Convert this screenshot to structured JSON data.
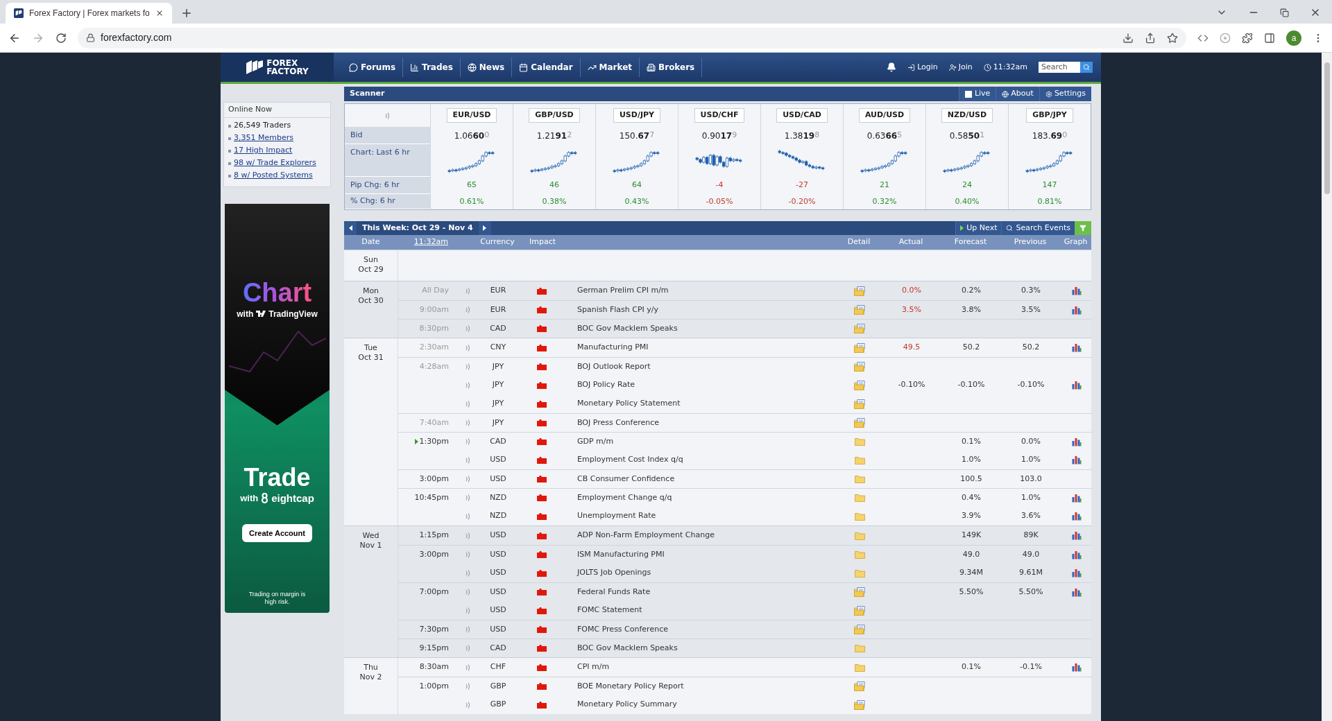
{
  "browser": {
    "tab_title": "Forex Factory | Forex markets fo",
    "url": "forexfactory.com",
    "profile_initial": "a"
  },
  "header": {
    "logo": [
      "FOREX",
      "FACTORY"
    ],
    "navigation": [
      {
        "label": "Forums"
      },
      {
        "label": "Trades"
      },
      {
        "label": "News"
      },
      {
        "label": "Calendar"
      },
      {
        "label": "Market"
      },
      {
        "label": "Brokers"
      }
    ],
    "login": "Login",
    "join": "Join",
    "time": "11:32am",
    "search": {
      "placeholder": "Search"
    }
  },
  "sidebar": {
    "title": "Online Now",
    "items": [
      {
        "label": "26,549 Traders",
        "kind": "text"
      },
      {
        "label": "3,351 Members",
        "kind": "link"
      },
      {
        "label": "17 High Impact",
        "kind": "link"
      },
      {
        "label": "98 w/ Trade Explorers",
        "kind": "link"
      },
      {
        "label": "8 w/ Posted Systems",
        "kind": "link"
      }
    ],
    "ad": {
      "headline": "Chart",
      "with_1": "with",
      "brand_1": "TradingView",
      "headline_2": "Trade",
      "with_2": "with",
      "brand_2": "eightcap",
      "cta": "Create Account",
      "disclaimer": "Trading on margin is high risk."
    }
  },
  "scanner": {
    "title": "Scanner",
    "live": {
      "label": "Live",
      "checked": false
    },
    "about": "About",
    "settings": "Settings",
    "row_labels": [
      "Bid",
      "Chart: Last 6 hr",
      "Pip Chg: 6 hr",
      "% Chg: 6 hr"
    ],
    "pairs": [
      {
        "symbol": "EUR/USD",
        "bid_main": "1.06",
        "bid_pips": "60",
        "bid_fraction": "0",
        "kind": "rising",
        "pip_change": "65",
        "pct_change": "0.61%",
        "positive": true
      },
      {
        "symbol": "GBP/USD",
        "bid_main": "1.21",
        "bid_pips": "91",
        "bid_fraction": "2",
        "kind": "rising",
        "pip_change": "46",
        "pct_change": "0.38%",
        "positive": true
      },
      {
        "symbol": "USD/JPY",
        "bid_main": "150.",
        "bid_pips": "67",
        "bid_fraction": "7",
        "kind": "rising",
        "pip_change": "64",
        "pct_change": "0.43%",
        "positive": true
      },
      {
        "symbol": "USD/CHF",
        "bid_main": "0.90",
        "bid_pips": "17",
        "bid_fraction": "9",
        "kind": "choppy",
        "pip_change": "-4",
        "pct_change": "-0.05%",
        "positive": false
      },
      {
        "symbol": "USD/CAD",
        "bid_main": "1.38",
        "bid_pips": "19",
        "bid_fraction": "8",
        "kind": "falling",
        "pip_change": "-27",
        "pct_change": "-0.20%",
        "positive": false
      },
      {
        "symbol": "AUD/USD",
        "bid_main": "0.63",
        "bid_pips": "66",
        "bid_fraction": "5",
        "kind": "rising",
        "pip_change": "21",
        "pct_change": "0.32%",
        "positive": true
      },
      {
        "symbol": "NZD/USD",
        "bid_main": "0.58",
        "bid_pips": "50",
        "bid_fraction": "1",
        "kind": "rising",
        "pip_change": "24",
        "pct_change": "0.40%",
        "positive": true
      },
      {
        "symbol": "GBP/JPY",
        "bid_main": "183.",
        "bid_pips": "69",
        "bid_fraction": "0",
        "kind": "rising",
        "pip_change": "147",
        "pct_change": "0.81%",
        "positive": true
      }
    ]
  },
  "calendar": {
    "week": "This Week: Oct 29 - Nov 4",
    "up_next": "Up Next",
    "search_events": "Search Events",
    "columns": [
      "Date",
      "11:32am",
      "Currency",
      "Impact",
      "Detail",
      "Actual",
      "Forecast",
      "Previous",
      "Graph"
    ],
    "days": [
      {
        "weekday": "Sun",
        "date": "Oct 29"
      },
      {
        "weekday": "Mon",
        "date": "Oct 30",
        "events": [
          {
            "time": "All Day",
            "past": true,
            "currency": "EUR",
            "event": "German Prelim CPI m/m",
            "kind": "folder-page",
            "actual": "0.0%",
            "actual_worse": true,
            "forecast": "0.2%",
            "previous": "0.3%",
            "graph": true
          },
          {
            "time": "9:00am",
            "past": true,
            "currency": "EUR",
            "event": "Spanish Flash CPI y/y",
            "kind": "folder-page",
            "actual": "3.5%",
            "actual_worse": true,
            "forecast": "3.8%",
            "previous": "3.5%",
            "graph": true
          },
          {
            "time": "8:30pm",
            "past": true,
            "currency": "CAD",
            "event": "BOC Gov Macklem Speaks",
            "kind": "folder-page",
            "graph": false
          }
        ]
      },
      {
        "weekday": "Tue",
        "date": "Oct 31",
        "events": [
          {
            "time": "2:30am",
            "past": true,
            "currency": "CNY",
            "event": "Manufacturing PMI",
            "kind": "folder-page",
            "actual": "49.5",
            "actual_worse": true,
            "forecast": "50.2",
            "previous": "50.2",
            "graph": true
          },
          {
            "time": "4:28am",
            "past": true,
            "currency": "JPY",
            "event": "BOJ Outlook Report",
            "kind": "folder-page",
            "graph": false
          },
          {
            "currency": "JPY",
            "event": "BOJ Policy Rate",
            "kind": "folder-page",
            "actual": "-0.10%",
            "actual_worse": false,
            "forecast": "-0.10%",
            "previous": "-0.10%",
            "graph": true
          },
          {
            "currency": "JPY",
            "event": "Monetary Policy Statement",
            "kind": "folder-page",
            "graph": false
          },
          {
            "time": "7:40am",
            "past": true,
            "currency": "JPY",
            "event": "BOJ Press Conference",
            "kind": "folder-page",
            "graph": false
          },
          {
            "time": "1:30pm",
            "past": false,
            "up_next": true,
            "currency": "CAD",
            "event": "GDP m/m",
            "kind": "folder",
            "forecast": "0.1%",
            "previous": "0.0%",
            "graph": true
          },
          {
            "currency": "USD",
            "event": "Employment Cost Index q/q",
            "kind": "folder",
            "forecast": "1.0%",
            "previous": "1.0%",
            "graph": true
          },
          {
            "time": "3:00pm",
            "past": false,
            "currency": "USD",
            "event": "CB Consumer Confidence",
            "kind": "folder",
            "forecast": "100.5",
            "previous": "103.0",
            "graph": false
          },
          {
            "time": "10:45pm",
            "past": false,
            "currency": "NZD",
            "event": "Employment Change q/q",
            "kind": "folder",
            "forecast": "0.4%",
            "previous": "1.0%",
            "graph": true
          },
          {
            "currency": "NZD",
            "event": "Unemployment Rate",
            "kind": "folder",
            "forecast": "3.9%",
            "previous": "3.6%",
            "graph": true
          }
        ]
      },
      {
        "weekday": "Wed",
        "date": "Nov 1",
        "events": [
          {
            "time": "1:15pm",
            "past": false,
            "currency": "USD",
            "event": "ADP Non-Farm Employment Change",
            "kind": "folder",
            "forecast": "149K",
            "previous": "89K",
            "graph": true
          },
          {
            "time": "3:00pm",
            "past": false,
            "currency": "USD",
            "event": "ISM Manufacturing PMI",
            "kind": "folder",
            "forecast": "49.0",
            "previous": "49.0",
            "graph": true
          },
          {
            "currency": "USD",
            "event": "JOLTS Job Openings",
            "kind": "folder",
            "forecast": "9.34M",
            "previous": "9.61M",
            "graph": true
          },
          {
            "time": "7:00pm",
            "past": false,
            "currency": "USD",
            "event": "Federal Funds Rate",
            "kind": "folder-page",
            "forecast": "5.50%",
            "previous": "5.50%",
            "graph": true
          },
          {
            "currency": "USD",
            "event": "FOMC Statement",
            "kind": "folder-page",
            "graph": false
          },
          {
            "time": "7:30pm",
            "past": false,
            "currency": "USD",
            "event": "FOMC Press Conference",
            "kind": "folder-page",
            "graph": false
          },
          {
            "time": "9:15pm",
            "past": false,
            "currency": "CAD",
            "event": "BOC Gov Macklem Speaks",
            "kind": "folder",
            "graph": false
          }
        ]
      },
      {
        "weekday": "Thu",
        "date": "Nov 2",
        "events": [
          {
            "time": "8:30am",
            "past": false,
            "currency": "CHF",
            "event": "CPI m/m",
            "kind": "folder",
            "forecast": "0.1%",
            "previous": "-0.1%",
            "graph": true
          },
          {
            "time": "1:00pm",
            "past": false,
            "currency": "GBP",
            "event": "BOE Monetary Policy Report",
            "kind": "folder-page",
            "graph": false
          },
          {
            "currency": "GBP",
            "event": "Monetary Policy Summary",
            "kind": "folder-page",
            "graph": false
          }
        ]
      }
    ]
  }
}
